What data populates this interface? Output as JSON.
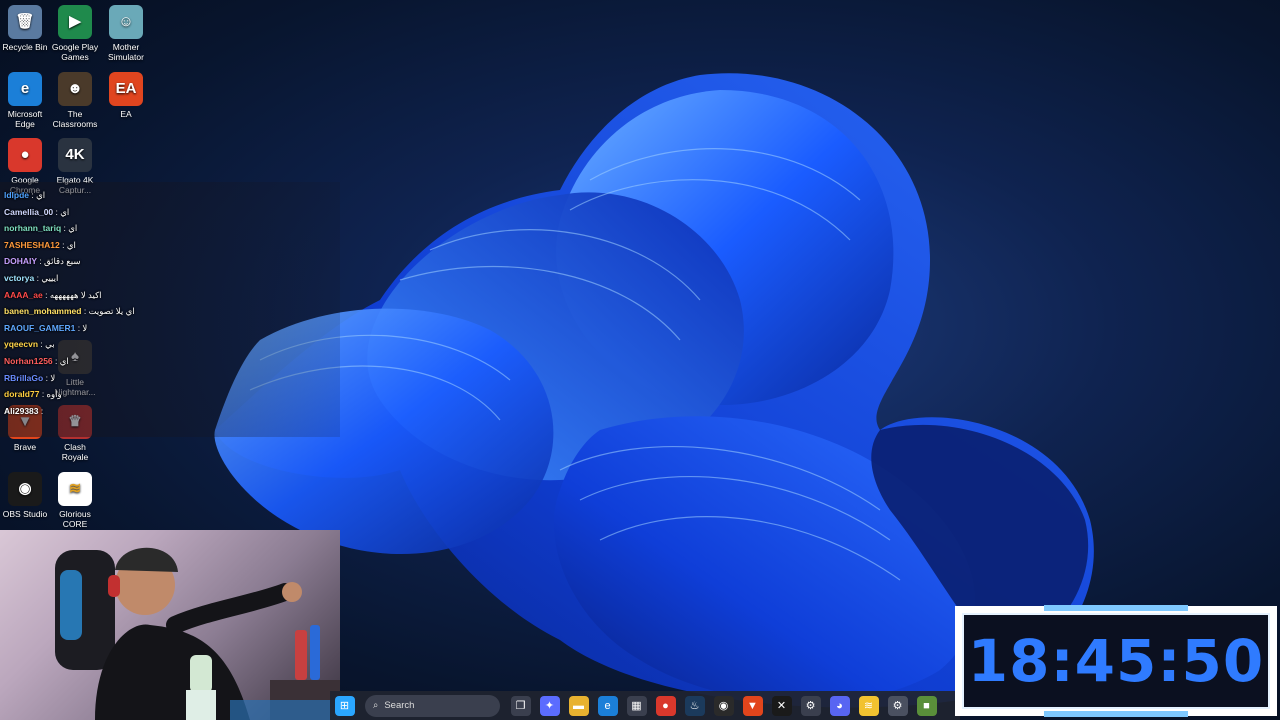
{
  "desktop_icons": [
    {
      "label": "Recycle Bin",
      "glyph": "🗑",
      "icon": "recycle-bin-icon",
      "color": "#5a7aa0"
    },
    {
      "label": "Google Play Games",
      "glyph": "▶",
      "icon": "google-play-games-icon",
      "color": "#1f8a4c"
    },
    {
      "label": "Mother Simulator",
      "glyph": "☺",
      "icon": "mother-simulator-icon",
      "color": "#6aa9b8"
    },
    {
      "label": "Microsoft Edge",
      "glyph": "e",
      "icon": "edge-icon",
      "color": "#1b7fd8"
    },
    {
      "label": "The Classrooms",
      "glyph": "☻",
      "icon": "the-classrooms-icon",
      "color": "#4a3a2a"
    },
    {
      "label": "EA",
      "glyph": "EA",
      "icon": "ea-icon",
      "color": "#e0451f"
    },
    {
      "label": "Google Chrome",
      "glyph": "●",
      "icon": "chrome-icon",
      "color": "#d9382c"
    },
    {
      "label": "Elgato 4K Captur...",
      "glyph": "4K",
      "icon": "elgato-4k-icon",
      "color": "#2a3340"
    },
    {
      "label": "Little Nightmar...",
      "glyph": "♠",
      "icon": "little-nightmares-icon",
      "color": "#3a3a3a"
    },
    {
      "label": "Brave",
      "glyph": "▼",
      "icon": "brave-icon",
      "color": "#e2451c"
    },
    {
      "label": "Clash Royale",
      "glyph": "♛",
      "icon": "clash-royale-icon",
      "color": "#b33030"
    },
    {
      "label": "OBS Studio",
      "glyph": "◉",
      "icon": "obs-studio-icon",
      "color": "#1a1a1a"
    },
    {
      "label": "Glorious CORE",
      "glyph": "≋",
      "icon": "glorious-core-icon",
      "color": "#ffffff"
    }
  ],
  "chat": [
    {
      "user": "ldlpde",
      "msg": ": اي",
      "color": "#4fa3ff"
    },
    {
      "user": "Camellia_00",
      "msg": ": اي",
      "color": "#d0d8ff"
    },
    {
      "user": "norhann_tariq",
      "msg": ": اي",
      "color": "#7fe0c0"
    },
    {
      "user": "7ASHESHA12",
      "msg": ": اي",
      "color": "#ff9a3c"
    },
    {
      "user": "DOHAIY",
      "msg": ": سبع دقائق",
      "color": "#c7a0ff"
    },
    {
      "user": "vctorya",
      "msg": ": ايييي",
      "color": "#a0e4ff"
    },
    {
      "user": "AAAA_ae",
      "msg": ": اكيد لا ههههههه",
      "color": "#ff4a4a"
    },
    {
      "user": "banen_mohammed",
      "msg": ": اي يلا تصويت",
      "color": "#ffe066"
    },
    {
      "user": "RAOUF_GAMER1",
      "msg": ": لا",
      "color": "#5fa8ff"
    },
    {
      "user": "yqeecvn",
      "msg": ": بي",
      "color": "#ffd54a"
    },
    {
      "user": "Norhan1256",
      "msg": ": اي",
      "color": "#ff5e5e"
    },
    {
      "user": "RBrillaGo",
      "msg": ": لا",
      "color": "#6a8cff"
    },
    {
      "user": "dorald77",
      "msg": ": واوه",
      "color": "#ffcf40"
    },
    {
      "user": "Ali29383",
      "msg": ":",
      "color": "#ffffff"
    }
  ],
  "taskbar": {
    "search_placeholder": "Search",
    "icons": [
      {
        "name": "start-button",
        "glyph": "⊞",
        "color": "#2aa6ff"
      },
      {
        "name": "task-view-icon",
        "glyph": "❐",
        "color": "#3a3f4e"
      },
      {
        "name": "copilot-icon",
        "glyph": "✦",
        "color": "#5b6cff"
      },
      {
        "name": "file-explorer-icon",
        "glyph": "▬",
        "color": "#e8b230"
      },
      {
        "name": "edge-taskbar-icon",
        "glyph": "e",
        "color": "#1b7fd8"
      },
      {
        "name": "store-icon",
        "glyph": "▦",
        "color": "#3a3f4e"
      },
      {
        "name": "chrome-taskbar-icon",
        "glyph": "●",
        "color": "#d9382c"
      },
      {
        "name": "steam-icon",
        "glyph": "♨",
        "color": "#1b3a5c"
      },
      {
        "name": "obs-taskbar-icon",
        "glyph": "◉",
        "color": "#2a2a2a"
      },
      {
        "name": "brave-taskbar-icon",
        "glyph": "▼",
        "color": "#e2451c"
      },
      {
        "name": "capcut-icon",
        "glyph": "✕",
        "color": "#1a1a1a"
      },
      {
        "name": "settings-app-icon",
        "glyph": "⚙",
        "color": "#3a3f4e"
      },
      {
        "name": "discord-icon",
        "glyph": "◕",
        "color": "#5865f2"
      },
      {
        "name": "glorious-taskbar-icon",
        "glyph": "≋",
        "color": "#f2c230"
      },
      {
        "name": "settings-gear-icon",
        "glyph": "⚙",
        "color": "#4a5060"
      },
      {
        "name": "minecraft-icon",
        "glyph": "■",
        "color": "#5a8f3a"
      }
    ]
  },
  "clock": {
    "time": "18:45:50"
  }
}
